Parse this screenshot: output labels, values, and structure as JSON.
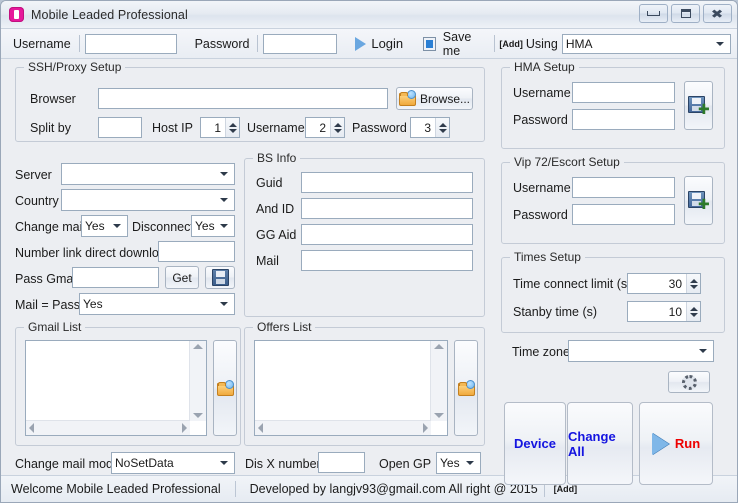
{
  "window": {
    "title": "Mobile Leaded Professional",
    "app_icon": "mobile-phone-icon",
    "controls": {
      "minimize": "minimize-icon",
      "maximize": "maximize-icon",
      "close": "close-icon"
    },
    "accent": "#e6189b",
    "background": "#eceef2"
  },
  "loginbar": {
    "username_label": "Username",
    "username_value": "",
    "password_label": "Password",
    "password_value": "",
    "login_label": "Login",
    "login_icon": "play-triangle-icon",
    "save_me_label": "Save me",
    "save_me_checked": true,
    "add_tag": "[Add]",
    "using_label": "Using",
    "using_value": "HMA"
  },
  "ssh_proxy": {
    "caption": "SSH/Proxy Setup",
    "browser_label": "Browser",
    "browser_value": "",
    "browse_button": "Browse...",
    "browse_icon": "folder-open-icon",
    "split_by_label": "Split by",
    "split_by_value": "",
    "host_ip_label": "Host IP",
    "host_ip_value": "1",
    "username_label": "Username",
    "username_value": "2",
    "password_label": "Password",
    "password_value": "3"
  },
  "main_left": {
    "server_label": "Server",
    "server_value": "",
    "country_label": "Country",
    "country_value": "",
    "change_mail_label": "Change mail",
    "change_mail_value": "Yes",
    "disconnect_label": "Disconnect",
    "disconnect_value": "Yes",
    "number_link_label": "Number link direct download",
    "number_link_value": "",
    "pass_gmail_label": "Pass Gmail",
    "pass_gmail_value": "",
    "get_button": "Get",
    "save_icon": "floppy-disk-icon",
    "mail_eq_pass_label": "Mail = Pass",
    "mail_eq_pass_value": "Yes"
  },
  "bs_info": {
    "caption": "BS Info",
    "guid_label": "Guid",
    "guid_value": "",
    "and_id_label": "And ID",
    "and_id_value": "",
    "gg_aid_label": "GG Aid",
    "gg_aid_value": "",
    "mail_label": "Mail",
    "mail_value": ""
  },
  "gmail_list": {
    "caption": "Gmail List",
    "items": [],
    "load_icon": "folder-open-refresh-icon"
  },
  "offers_list": {
    "caption": "Offers List",
    "items": [],
    "load_icon": "folder-open-refresh-icon"
  },
  "bottom_row": {
    "change_mail_mode_label": "Change mail mode",
    "change_mail_mode_value": "NoSetData",
    "dis_x_number_label": "Dis X number",
    "dis_x_number_value": "",
    "open_gp_label": "Open GP",
    "open_gp_value": "Yes"
  },
  "hma_setup": {
    "caption": "HMA Setup",
    "username_label": "Username",
    "username_value": "",
    "password_label": "Password",
    "password_value": "",
    "save_icon": "floppy-disk-add-icon"
  },
  "vip72_setup": {
    "caption": "Vip 72/Escort Setup",
    "username_label": "Username",
    "username_value": "",
    "password_label": "Password",
    "password_value": "",
    "save_icon": "floppy-disk-add-icon"
  },
  "times_setup": {
    "caption": "Times Setup",
    "time_connect_limit_label": "Time connect limit (s)",
    "time_connect_limit_value": "30",
    "standby_time_label": "Stanby time (s)",
    "standby_time_value": "10"
  },
  "time_zone": {
    "label": "Time zone",
    "value": "",
    "settings_icon": "gear-icon"
  },
  "actions": {
    "device_label": "Device",
    "change_all_label": "Change All",
    "run_label": "Run",
    "run_icon": "play-triangle-icon",
    "label_color": "#1414e0",
    "run_color": "#ee0000"
  },
  "statusbar": {
    "welcome": "Welcome Mobile Leaded Professional",
    "developed_by": "Developed by langjv93@gmail.com All right @ 2015",
    "add_tag": "[Add]"
  }
}
